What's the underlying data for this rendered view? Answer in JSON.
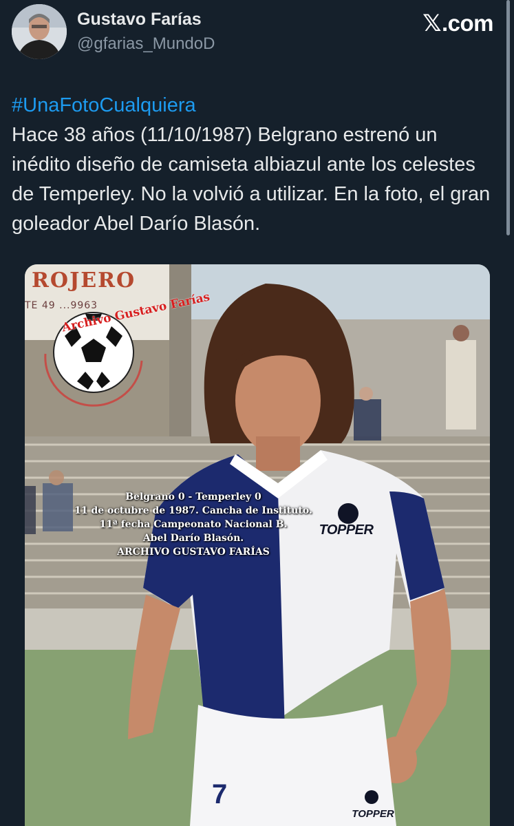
{
  "author": {
    "name": "Gustavo Farías",
    "handle": "@gfarias_MundoD",
    "avatar_icon": "avatar-photo"
  },
  "brand": {
    "x_glyph": "𝕏",
    "text": ".com"
  },
  "tweet": {
    "hashtag": "#UnaFotoCualquiera",
    "body": "Hace 38 años (11/10/1987) Belgrano estrenó un inédito diseño de camiseta albiazul ante los celestes de Temperley. No la volvió a utilizar. En la foto, el gran goleador Abel Darío Blasón."
  },
  "photo": {
    "watermark_text": "Archivo Gustavo Farías",
    "sign_text_top": "ROJERO",
    "sign_text_bottom": "TE 49 ...9963",
    "caption_lines": [
      "Belgrano 0 - Temperley 0",
      "11 de octubre de 1987. Cancha de Instituto.",
      "11ª fecha Campeonato Nacional B.",
      "Abel Darío Blasón.",
      "ARCHIVO GUSTAVO FARÍAS"
    ],
    "shirt_brand": "TOPPER",
    "shorts_brand": "TOPPER",
    "shorts_number": "7"
  },
  "colors": {
    "background": "#15202b",
    "link": "#1d9bf0",
    "shirt_blue": "#1c2a6e"
  }
}
